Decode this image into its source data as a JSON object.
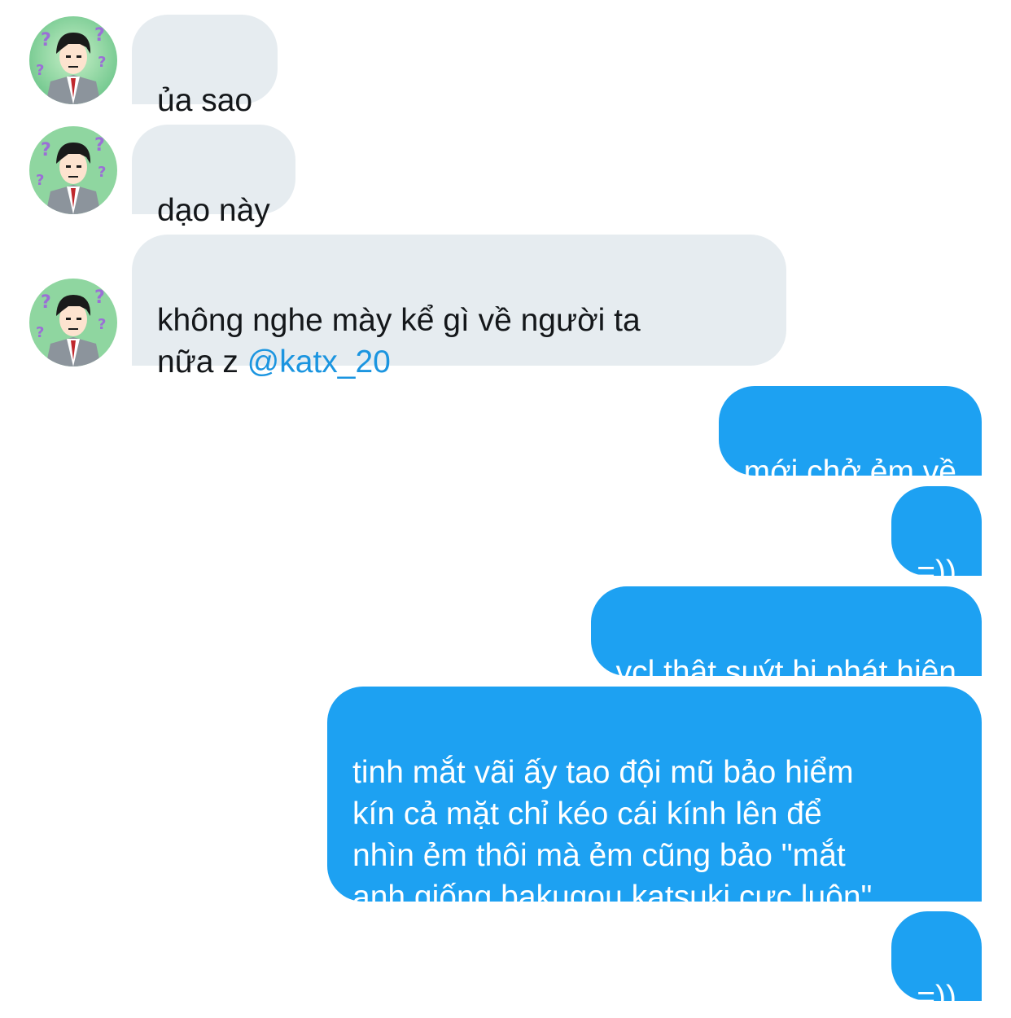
{
  "conversation": {
    "messages": [
      {
        "sender": "other",
        "text": "ủa sao"
      },
      {
        "sender": "other",
        "text": "dạo này"
      },
      {
        "sender": "other",
        "text": "không nghe mày kể gì về người ta\nnữa z ",
        "mention": "@katx_20"
      },
      {
        "sender": "me",
        "text": "mới chở ẻm về"
      },
      {
        "sender": "me",
        "text": "=))"
      },
      {
        "sender": "me",
        "text": "vcl thật suýt bị phát hiện"
      },
      {
        "sender": "me",
        "text": "tinh mắt vãi ấy tao đội mũ bảo hiểm\nkín cả mặt chỉ kéo cái kính lên để\nnhìn ẻm thôi mà ẻm cũng bảo \"mắt\nanh giống bakugou katsuki cực luôn\""
      },
      {
        "sender": "me",
        "text": "=))"
      }
    ]
  },
  "colors": {
    "incoming_bubble": "#e6ecf0",
    "outgoing_bubble": "#1da1f2",
    "mention": "#1b95e0"
  },
  "icons": {
    "avatar": "anime-character-avatar-icon"
  }
}
